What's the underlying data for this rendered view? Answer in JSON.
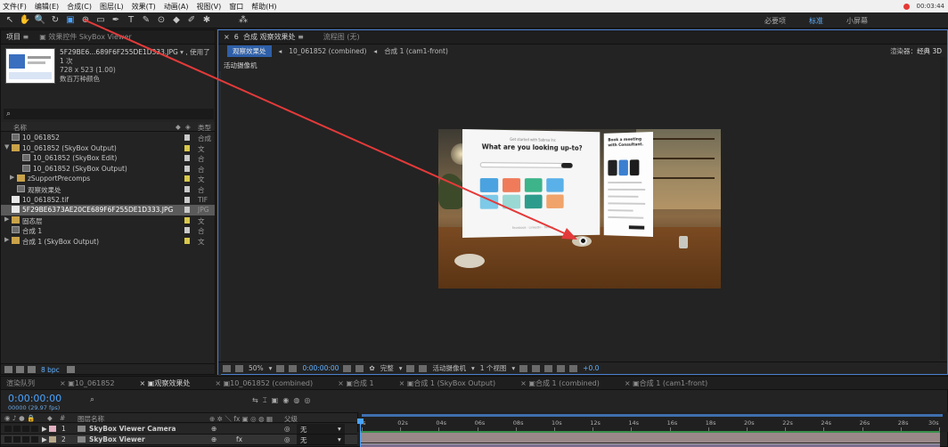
{
  "menu": [
    "文件(F)",
    "编辑(E)",
    "合成(C)",
    "图层(L)",
    "效果(T)",
    "动画(A)",
    "视图(V)",
    "窗口",
    "帮助(H)"
  ],
  "recording_time": "00:03:44",
  "workspaces": [
    "必要项",
    "标准",
    "小屏幕"
  ],
  "workspace_active": "标准",
  "toolbar_icons": [
    "selection-tool",
    "hand-tool",
    "zoom-tool",
    "rotate-tool",
    "camera-tool",
    "pan-behind-tool",
    "rectangle-tool",
    "pen-tool",
    "type-tool",
    "brush-tool",
    "clone-stamp-tool",
    "eraser-tool",
    "roto-brush-tool",
    "puppet-tool",
    "axis-mode"
  ],
  "project": {
    "tabs": [
      "项目",
      "效果控件 SkyBox Viewer"
    ],
    "selected_file": "5F29BE6...689F6F255DE1D333.JPG",
    "used_count": "▾ , 使用了 1 次",
    "dimensions": "728 x 523 (1.00)",
    "color_info": "数百万种颜色",
    "search_icon": "⌕",
    "col_name": "名称",
    "col_type": "类型",
    "items": [
      {
        "name": "10_061852",
        "kind": "comp",
        "indent": 0,
        "twirl": "",
        "type": "合成",
        "label": "#c9c9c9"
      },
      {
        "name": "10_061852 (SkyBox Output)",
        "kind": "folder",
        "indent": 0,
        "twirl": "▼",
        "type": "文",
        "label": "#d8c84a"
      },
      {
        "name": "10_061852 (SkyBox Edit)",
        "kind": "comp",
        "indent": 2,
        "twirl": "",
        "type": "合",
        "label": "#c9c9c9"
      },
      {
        "name": "10_061852 (SkyBox Output)",
        "kind": "comp",
        "indent": 2,
        "twirl": "",
        "type": "合",
        "label": "#c9c9c9"
      },
      {
        "name": "zSupportPrecomps",
        "kind": "folder",
        "indent": 1,
        "twirl": "▶",
        "type": "文",
        "label": "#d8c84a"
      },
      {
        "name": "观察效果处",
        "kind": "comp",
        "indent": 1,
        "twirl": "",
        "type": "合",
        "label": "#c9c9c9"
      },
      {
        "name": "10_061852.tif",
        "kind": "file",
        "indent": 0,
        "twirl": "",
        "type": "TIF",
        "label": "#c9c9c9"
      },
      {
        "name": "5F29BE6373AE20CE689F6F255DE1D333.JPG",
        "kind": "file",
        "indent": 0,
        "twirl": "",
        "type": "JPG",
        "label": "#c9c9c9",
        "selected": true
      },
      {
        "name": "固态层",
        "kind": "folder",
        "indent": 0,
        "twirl": "▶",
        "type": "文",
        "label": "#d8c84a"
      },
      {
        "name": "合成 1",
        "kind": "comp",
        "indent": 0,
        "twirl": "",
        "type": "合",
        "label": "#c9c9c9"
      },
      {
        "name": "合成 1 (SkyBox Output)",
        "kind": "folder",
        "indent": 0,
        "twirl": "▶",
        "type": "文",
        "label": "#d8c84a"
      }
    ],
    "bpc": "8 bpc"
  },
  "viewer": {
    "tabs": [
      "合成 观察效果处",
      "流程图 (无)"
    ],
    "close": "×",
    "lock": "6",
    "tab_menu": "≡",
    "active_chip": "观察效果处",
    "crumbs": [
      "10_061852 (combined)",
      "合成 1 (cam1-front)"
    ],
    "renderer_label": "渲染器：",
    "renderer_value": "经典 3D",
    "camera_label": "活动摄像机",
    "footer": {
      "zoom": "50%",
      "time": "0:00:00:00",
      "quality": "完整",
      "camera": "活动摄像机",
      "views": "1 个视图",
      "offset": "+0.0"
    },
    "scene": {
      "brand": "Get started with Sabrea Inc",
      "headline": "What are you looking up-to?",
      "footer_links": "Facebook · LinkedIn · Twitter",
      "side_title": "Book a meeting with Consultant.",
      "card_colors": [
        "#4aa3e0",
        "#ef7b5a",
        "#3db48a",
        "#5ab0e8",
        "#7dc9e8",
        "#9ad8d4",
        "#2e9c8c",
        "#f0a36a"
      ]
    }
  },
  "timeline": {
    "tabs": [
      "渲染队列",
      "10_061852",
      "观察效果处",
      "10_061852 (combined)",
      "合成 1",
      "合成 1 (SkyBox Output)",
      "合成 1 (combined)",
      "合成 1 (cam1-front)"
    ],
    "active_tab": "观察效果处",
    "timecode": "0:00:00:00",
    "fps": "00000 (29.97 fps)",
    "col_name": "图层名称",
    "col_parent": "父级",
    "ticks": [
      "0s",
      "02s",
      "04s",
      "06s",
      "08s",
      "10s",
      "12s",
      "14s",
      "16s",
      "18s",
      "20s",
      "22s",
      "24s",
      "26s",
      "28s",
      "30s"
    ],
    "layers": [
      {
        "num": "1",
        "name": "SkyBox Viewer Camera",
        "parent": "无",
        "color": "#e0b0c0"
      },
      {
        "num": "2",
        "name": "SkyBox Viewer",
        "parent": "无",
        "color": "#b8a88a",
        "fx": "fx"
      }
    ]
  }
}
